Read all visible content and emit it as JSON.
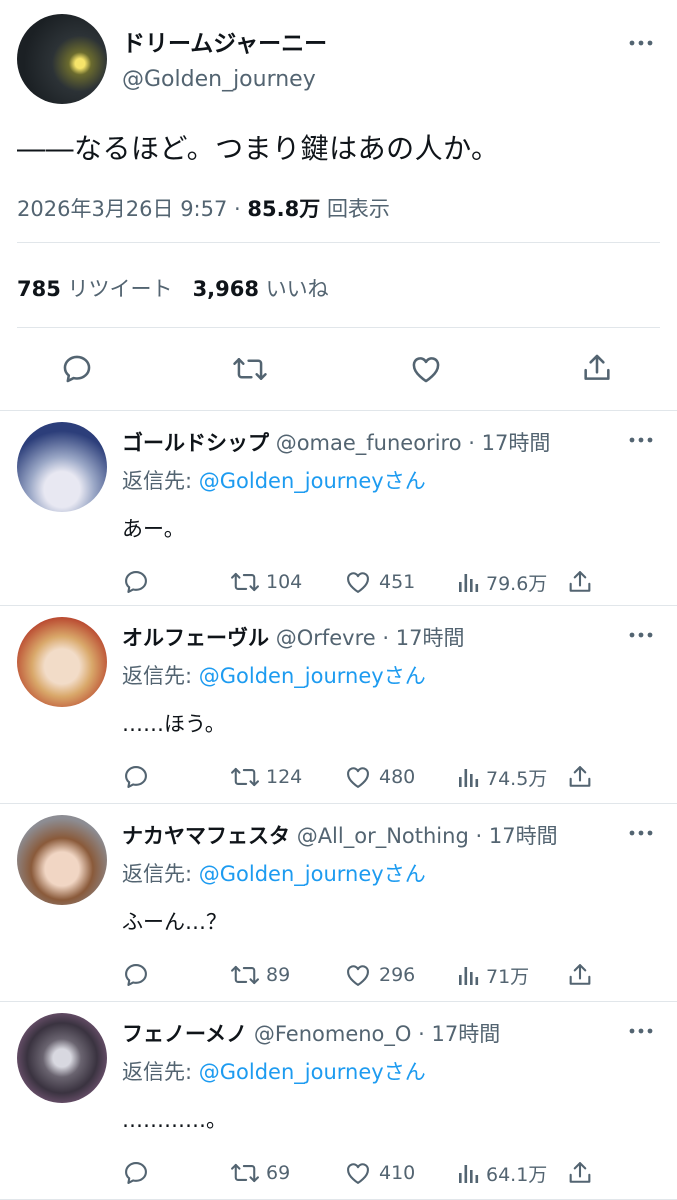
{
  "main": {
    "display_name": "ドリームジャーニー",
    "handle": "@Golden_journey",
    "text": "――なるほど。つまり鍵はあの人か。",
    "timestamp": "2026年3月26日 9:57",
    "meta_separator": "·",
    "views_count": "85.8万",
    "views_label": "回表示",
    "retweets_count": "785",
    "retweets_label": "リツイート",
    "likes_count": "3,968",
    "likes_label": "いいね"
  },
  "reply_prefix": "返信先:",
  "reply_mention": "@Golden_journeyさん",
  "replies": [
    {
      "display_name": "ゴールドシップ",
      "handle": "@omae_funeoriro",
      "time": "17時間",
      "text": "あー。",
      "retweets": "104",
      "likes": "451",
      "views": "79.6万"
    },
    {
      "display_name": "オルフェーヴル",
      "handle": "@Orfevre",
      "time": "17時間",
      "text": "……ほう。",
      "retweets": "124",
      "likes": "480",
      "views": "74.5万"
    },
    {
      "display_name": "ナカヤマフェスタ",
      "handle": "@All_or_Nothing",
      "time": "17時間",
      "text": "ふーん…？",
      "retweets": "89",
      "likes": "296",
      "views": "71万"
    },
    {
      "display_name": "フェノーメノ",
      "handle": "@Fenomeno_O",
      "time": "17時間",
      "text": "…………。",
      "retweets": "69",
      "likes": "410",
      "views": "64.1万"
    }
  ],
  "colors": {
    "text": "#0f1419",
    "secondary": "#536471",
    "link": "#1d9bf0",
    "divider": "#e1e6ea"
  }
}
